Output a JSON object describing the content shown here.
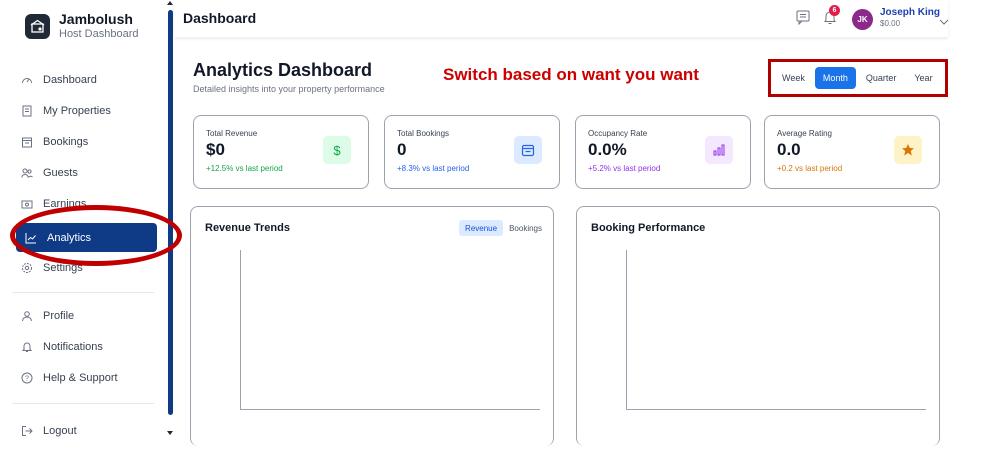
{
  "brand": {
    "title": "Jambolush",
    "subtitle": "Host Dashboard"
  },
  "sidebar": {
    "items": [
      {
        "label": "Dashboard",
        "icon": "speedometer-icon"
      },
      {
        "label": "My Properties",
        "icon": "building-icon"
      },
      {
        "label": "Bookings",
        "icon": "calendar-icon"
      },
      {
        "label": "Guests",
        "icon": "users-icon"
      },
      {
        "label": "Earnings",
        "icon": "money-icon"
      },
      {
        "label": "Analytics",
        "icon": "chart-line-icon",
        "active": true
      },
      {
        "label": "Settings",
        "icon": "gear-icon"
      },
      {
        "label": "Profile",
        "icon": "user-icon"
      },
      {
        "label": "Notifications",
        "icon": "bell-icon"
      },
      {
        "label": "Help & Support",
        "icon": "help-icon"
      },
      {
        "label": "Logout",
        "icon": "logout-icon"
      }
    ]
  },
  "topbar": {
    "title": "Dashboard",
    "notification_count": "6",
    "user": {
      "initials": "JK",
      "name": "Joseph King",
      "balance": "$0.00"
    }
  },
  "main": {
    "title": "Analytics Dashboard",
    "subtitle": "Detailed insights into your property performance",
    "annotation": "Switch based on want you want",
    "periods": [
      "Week",
      "Month",
      "Quarter",
      "Year"
    ],
    "active_period": "Month",
    "cards": [
      {
        "label": "Total Revenue",
        "value": "$0",
        "change": "+12.5% vs last period",
        "change_color": "#16a34a",
        "icon": "dollar-icon",
        "icon_bg": "#dcfce7",
        "icon_color": "#16a34a"
      },
      {
        "label": "Total Bookings",
        "value": "0",
        "change": "+8.3% vs last period",
        "change_color": "#2563eb",
        "icon": "calendar-check-icon",
        "icon_bg": "#dbeafe",
        "icon_color": "#2563eb"
      },
      {
        "label": "Occupancy Rate",
        "value": "0.0%",
        "change": "+5.2% vs last period",
        "change_color": "#9333ea",
        "icon": "bar-chart-icon",
        "icon_bg": "#f3e8ff",
        "icon_color": "#9333ea"
      },
      {
        "label": "Average Rating",
        "value": "0.0",
        "change": "+0.2 vs last period",
        "change_color": "#d97706",
        "icon": "star-icon",
        "icon_bg": "#fef3c7",
        "icon_color": "#d97706"
      }
    ],
    "panels": {
      "revenue": {
        "title": "Revenue Trends",
        "tabs": [
          "Revenue",
          "Bookings"
        ]
      },
      "booking": {
        "title": "Booking Performance"
      }
    }
  },
  "colors": {
    "primary": "#0f3a86",
    "accent": "#1a73e8",
    "annotation": "#cc0000"
  }
}
